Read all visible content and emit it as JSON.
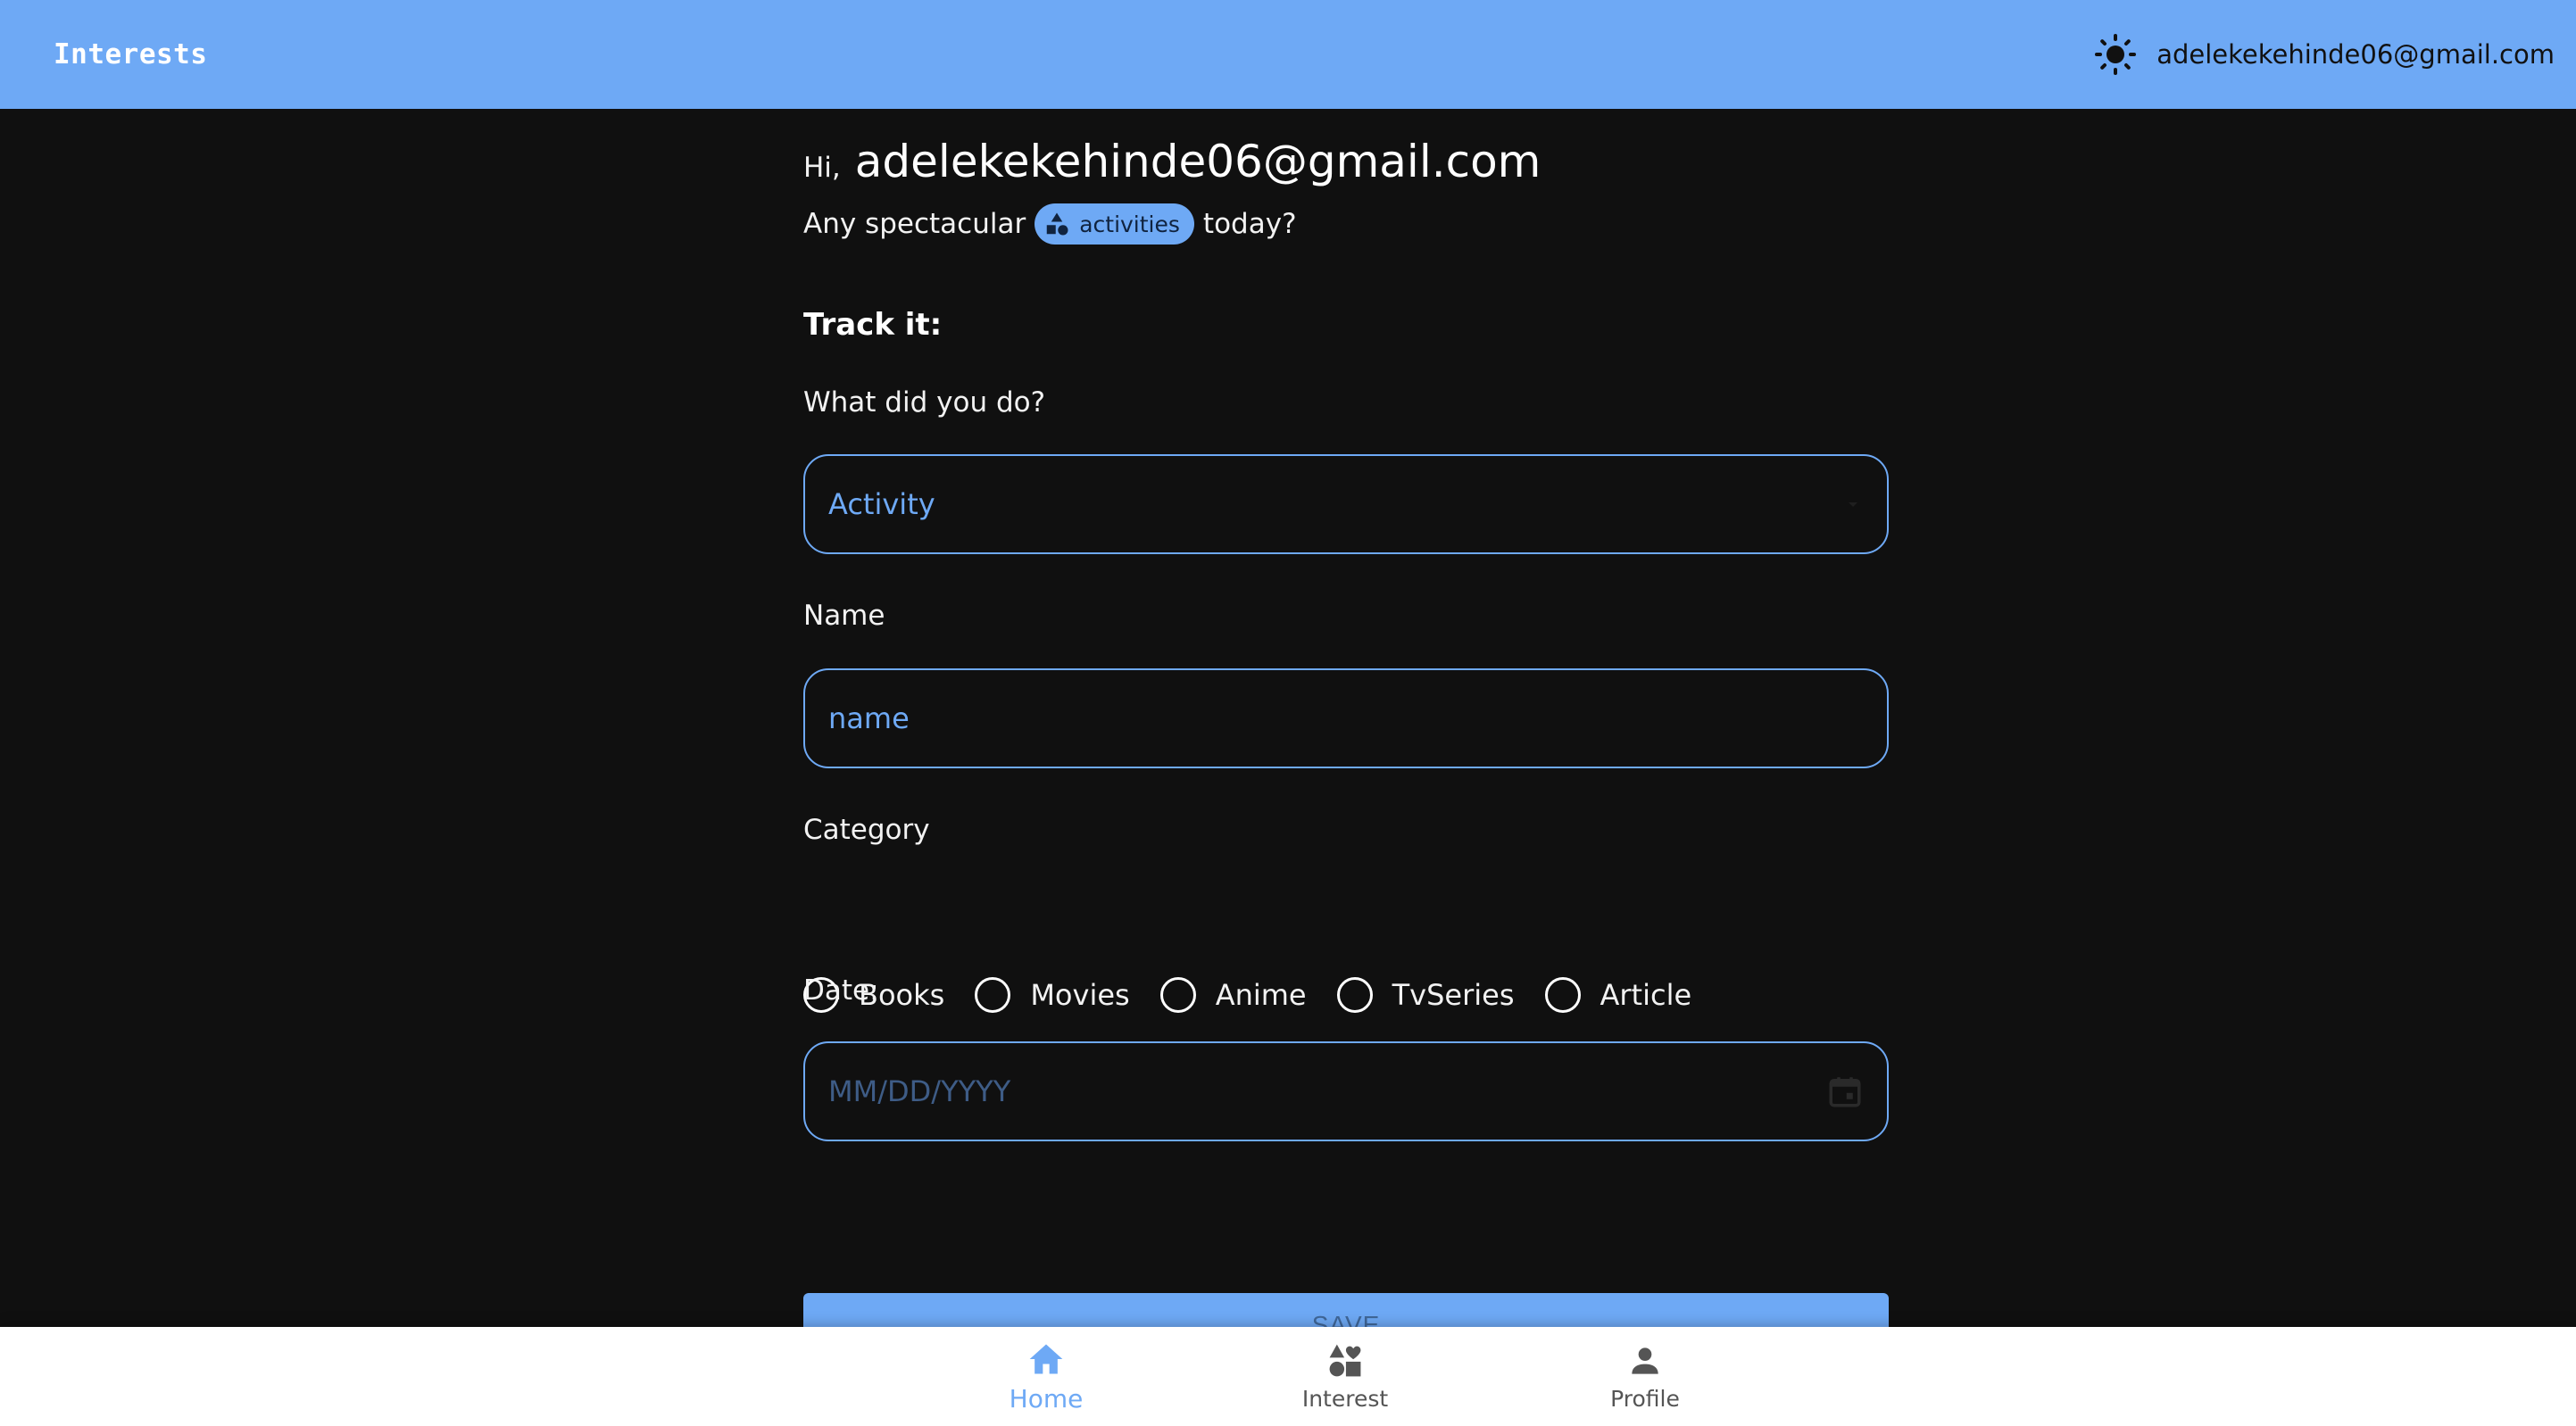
{
  "header": {
    "title": "Interests",
    "user_email": "adelekekehinde06@gmail.com",
    "theme_icon": "sun-icon"
  },
  "greeting": {
    "hi": "Hi,",
    "name": "adelekekehinde06@gmail.com"
  },
  "subline": {
    "before": "Any spectacular",
    "chip_label": "activities",
    "chip_icon": "category-icon",
    "after": "today?"
  },
  "form": {
    "section_title": "Track it:",
    "activity_question": "What did you do?",
    "activity_value": "Activity",
    "name_label": "Name",
    "name_placeholder": "name",
    "category_label": "Category",
    "categories": [
      "Books",
      "Movies",
      "Anime",
      "TvSeries",
      "Article"
    ],
    "date_label": "Date:",
    "date_placeholder": "MM/DD/YYYY",
    "save_label": "SAVE"
  },
  "nav": {
    "items": [
      {
        "label": "Home",
        "icon": "home-icon",
        "active": true
      },
      {
        "label": "Interest",
        "icon": "category-icon",
        "active": false
      },
      {
        "label": "Profile",
        "icon": "person-icon",
        "active": false
      }
    ]
  },
  "colors": {
    "accent": "#6ea9f5",
    "background": "#101010",
    "nav_background": "#ffffff"
  }
}
